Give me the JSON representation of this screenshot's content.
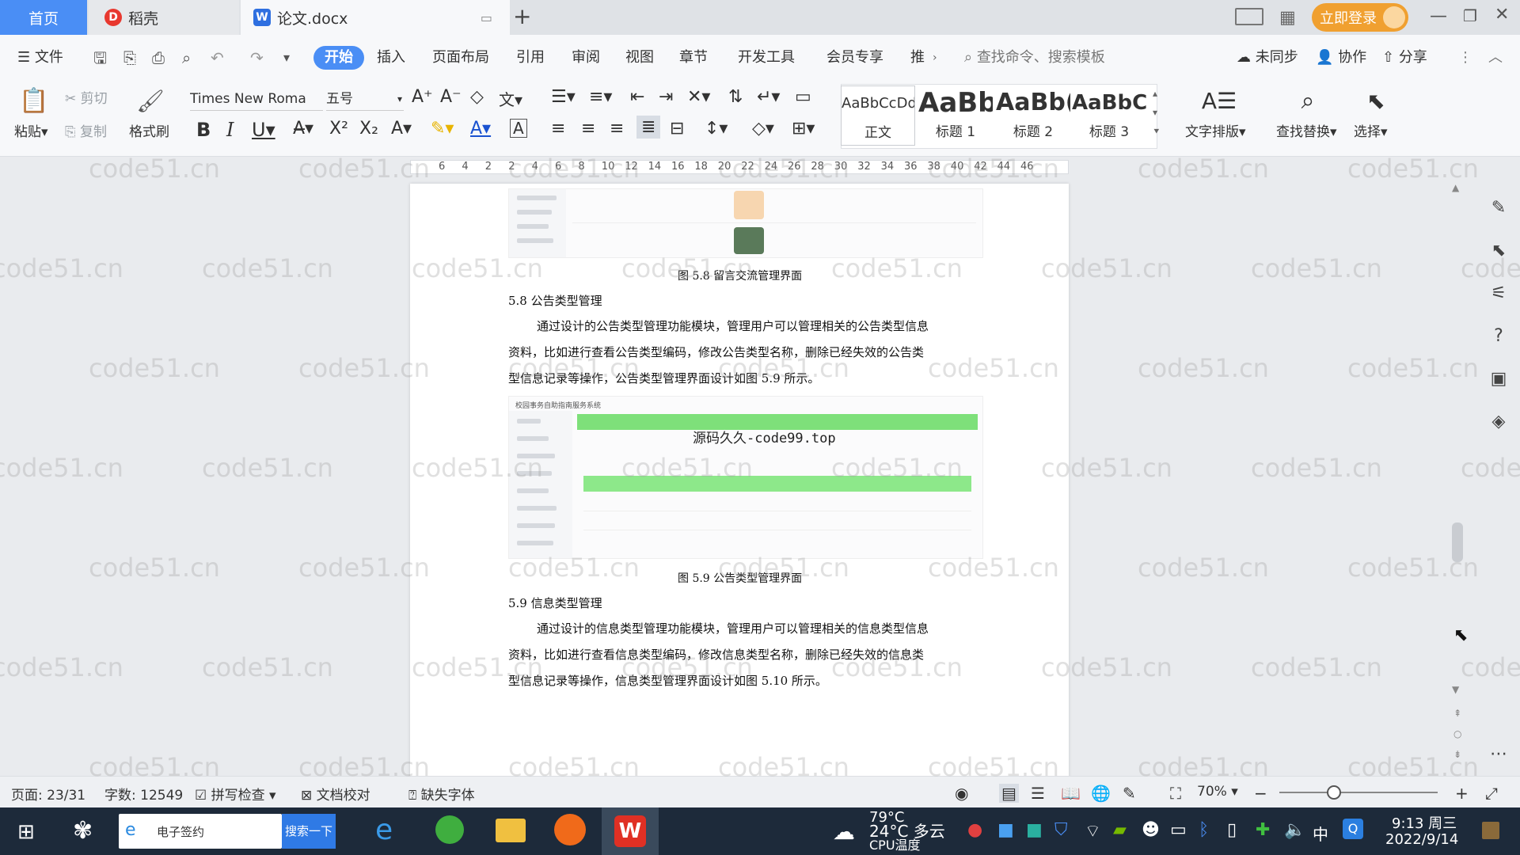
{
  "tabs": {
    "home": "首页",
    "daoke": "稻壳",
    "doc": "论文.docx",
    "new_tab": "+"
  },
  "titlebar": {
    "login": "立即登录"
  },
  "menu": {
    "file": "文件",
    "items": [
      "开始",
      "插入",
      "页面布局",
      "引用",
      "审阅",
      "视图",
      "章节",
      "开发工具",
      "会员专享",
      "推"
    ],
    "search_command": "查找命令、搜索模板",
    "sync": "未同步",
    "collab": "协作",
    "share": "分享"
  },
  "ribbon": {
    "paste": "粘贴",
    "cut": "剪切",
    "copy": "复制",
    "format_painter": "格式刷",
    "font_name": "Times New Roma",
    "font_size": "五号",
    "styles": [
      {
        "preview": "AaBbCcDd",
        "label": "正文"
      },
      {
        "preview": "AaBb",
        "label": "标题 1"
      },
      {
        "preview": "AaBb(",
        "label": "标题 2"
      },
      {
        "preview": "AaBbC",
        "label": "标题 3"
      }
    ],
    "text_layout": "文字排版",
    "find_replace": "查找替换",
    "select": "选择"
  },
  "ruler": {
    "ticks": [
      "6",
      "4",
      "2",
      "2",
      "4",
      "6",
      "8",
      "10",
      "12",
      "14",
      "16",
      "18",
      "20",
      "22",
      "24",
      "26",
      "28",
      "30",
      "32",
      "34",
      "36",
      "38",
      "40",
      "42",
      "44",
      "46"
    ]
  },
  "document": {
    "fig58_caption": "图 5.8 留言交流管理界面",
    "sec58_heading": "5.8 公告类型管理",
    "sec58_para": [
      "通过设计的公告类型管理功能模块，管理用户可以管理相关的公告类型信息",
      "资料，比如进行查看公告类型编码，修改公告类型名称，删除已经失效的公告类",
      "型信息记录等操作，公告类型管理界面设计如图 5.9 所示。"
    ],
    "fig59_title": "校园事务自助指南服务系统",
    "fig59_overlay": "源码久久-code99.top",
    "fig59_caption": "图 5.9 公告类型管理界面",
    "sec59_heading": "5.9 信息类型管理",
    "sec59_para": [
      "通过设计的信息类型管理功能模块，管理用户可以管理相关的信息类型信息",
      "资料，比如进行查看信息类型编码，修改信息类型名称，删除已经失效的信息类",
      "型信息记录等操作，信息类型管理界面设计如图 5.10 所示。"
    ]
  },
  "statusbar": {
    "page": "页面: 23/31",
    "words": "字数: 12549",
    "spellcheck": "拼写检查",
    "doc_check": "文档校对",
    "missing_fonts": "缺失字体",
    "zoom": "70%"
  },
  "taskbar": {
    "search_text": "电子签约",
    "search_button": "搜索一下",
    "weather_temp": "24°C 多云",
    "cpu_temp": "79°C",
    "cpu_label": "CPU温度",
    "ime": "中",
    "time": "9:13 周三",
    "date": "2022/9/14"
  },
  "watermark": "code51.cn",
  "colors": {
    "accent": "#4a8ef5",
    "login_orange": "#f0a030",
    "green": "#7ee07a"
  }
}
